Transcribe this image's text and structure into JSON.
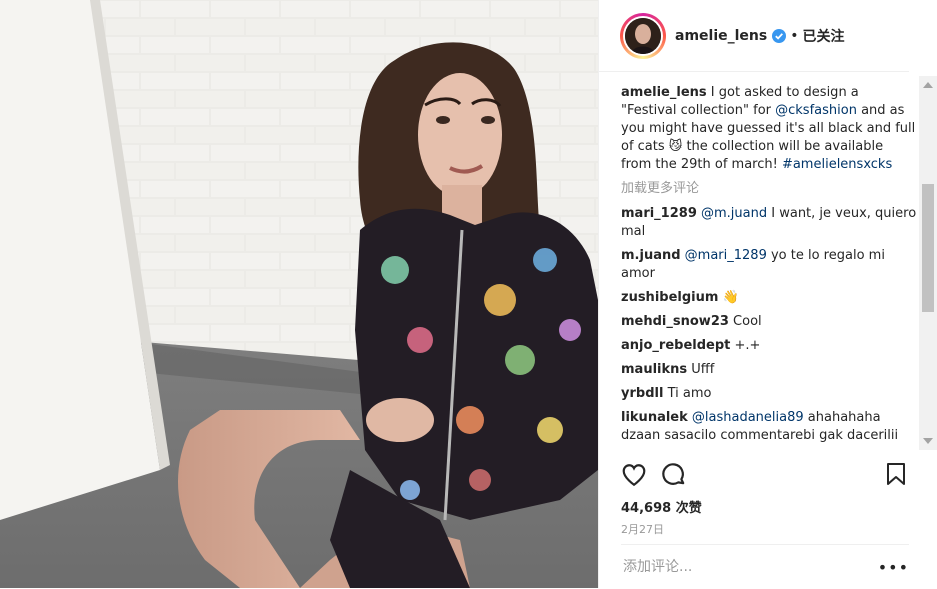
{
  "post": {
    "username": "amelie_lens",
    "following_label": "已关注",
    "separator": "•",
    "caption": {
      "username": "amelie_lens",
      "t1": "I got asked to design a \"Festival collection\" for ",
      "mention": "@cksfashion",
      "t2": " and as you might have guessed it's all black and full of cats 😼 the collection will be available from the 29th of march! ",
      "hashtag": "#amelielensxcks"
    },
    "load_more": "加载更多评论",
    "comments": [
      {
        "user": "mari_1289",
        "mention": "@m.juand",
        "text": " I want, je veux, quiero mal"
      },
      {
        "user": "m.juand",
        "mention": "@mari_1289",
        "text": " yo te lo regalo mi amor"
      },
      {
        "user": "zushibelgium",
        "mention": "",
        "text": "👋"
      },
      {
        "user": "mehdi_snow23",
        "mention": "",
        "text": "Cool"
      },
      {
        "user": "anjo_rebeldept",
        "mention": "",
        "text": "+.+"
      },
      {
        "user": "maulikns",
        "mention": "",
        "text": "Ufff"
      },
      {
        "user": "yrbdll",
        "mention": "",
        "text": "Ti amo"
      },
      {
        "user": "likunalek",
        "mention": "@lashadanelia89",
        "text": " ahahahaha dzaan sasacilo commentarebi gak dacerilii"
      }
    ],
    "likes": "44,698 次赞",
    "date": "2月27日",
    "add_comment_placeholder": "添加评论...",
    "more_label": "•••",
    "icons": {
      "like": "heart-icon",
      "comment": "comment-icon",
      "save": "bookmark-icon",
      "verified": "verified-badge-icon"
    },
    "colors": {
      "link": "#003569",
      "verified": "#3897f0",
      "muted": "#999999"
    }
  }
}
